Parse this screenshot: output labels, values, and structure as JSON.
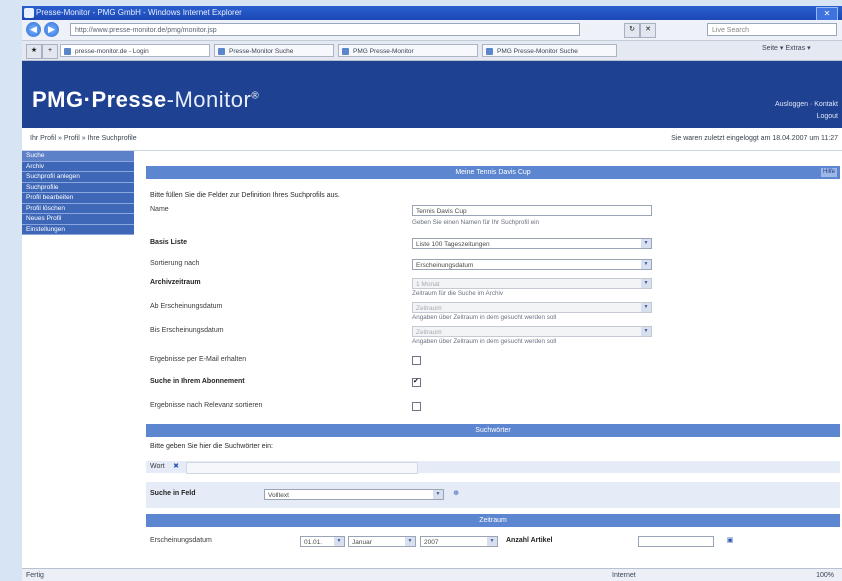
{
  "browser": {
    "title": "Presse-Monitor - PMG GmbH - Windows Internet Explorer",
    "address": "http://www.presse-monitor.de/pmg/monitor.jsp",
    "search_placeholder": "Live Search",
    "tabs": [
      "presse-monitor.de - Login",
      "Presse-Monitor Suche",
      "PMG Presse-Monitor",
      "PMG Presse-Monitor Suche"
    ],
    "tools": "Seite ▾   Extras ▾",
    "status_left": "Fertig",
    "status_mid": "Internet",
    "zoom": "100%"
  },
  "header": {
    "logo_main": "PMG·Pre",
    "logo_bold": "sse",
    "logo_rest": "-Monitor",
    "logo_reg": "®",
    "user_line1": "Ausloggen · Kontakt",
    "user_line2": "Logout"
  },
  "crumb": {
    "path": "Ihr Profil » Profil » Ihre Suchprofile",
    "login_info": "Sie waren zuletzt eingeloggt am 18.04.2007 um 11:27"
  },
  "sidebar": {
    "items": [
      "Suche",
      "Archiv",
      "Suchprofil anlegen",
      "Suchprofile",
      "Profil bearbeiten",
      "Profil löschen",
      "Neues Profil",
      "Einstellungen"
    ]
  },
  "main": {
    "section_title": "Meine Tennis Davis Cup",
    "help": "Hilfe",
    "intro": "Bitte füllen Sie die Felder zur Definition Ihres Suchprofils aus.",
    "name_label": "Name",
    "name_value": "Tennis Davis Cup",
    "name_note": "Geben Sie einen Namen für Ihr Suchprofil ein",
    "basis_label": "Basis Liste",
    "basis_value": "Liste 100 Tageszeitungen",
    "sort_label": "Sortierung nach",
    "sort_value": "Erscheinungsdatum",
    "archive_label": "Archivzeitraum",
    "archive_value": "1 Monat",
    "archive_note": "Zeitraum für die Suche im Archiv",
    "from_label": "Ab Erscheinungsdatum",
    "from_value": "Zeitraum",
    "from_note": "Angaben über Zeitraum in dem gesucht werden soll",
    "until_label": "Bis Erscheinungsdatum",
    "until_value": "Zeitraum",
    "until_note": "Angaben über Zeitraum in dem gesucht werden soll",
    "opt1_label": "Ergebnisse per E-Mail erhalten",
    "opt2_label": "Suche in Ihrem Abonnement",
    "opt3_label": "Ergebnisse nach Relevanz sortieren",
    "opt1_checked": false,
    "opt2_checked": true,
    "opt3_checked": false
  },
  "search_words": {
    "title": "Suchwörter",
    "intro": "Bitte geben Sie hier die Suchwörter ein:",
    "token_label": "Wort",
    "field_label": "Suche in Feld",
    "field_value": "Volltext"
  },
  "zeitraum": {
    "title": "Zeitraum",
    "label": "Erscheinungsdatum",
    "v1": "01.01.",
    "v2": "Januar",
    "v3": "2007",
    "count_label": "Anzahl Artikel",
    "count_value": ""
  }
}
